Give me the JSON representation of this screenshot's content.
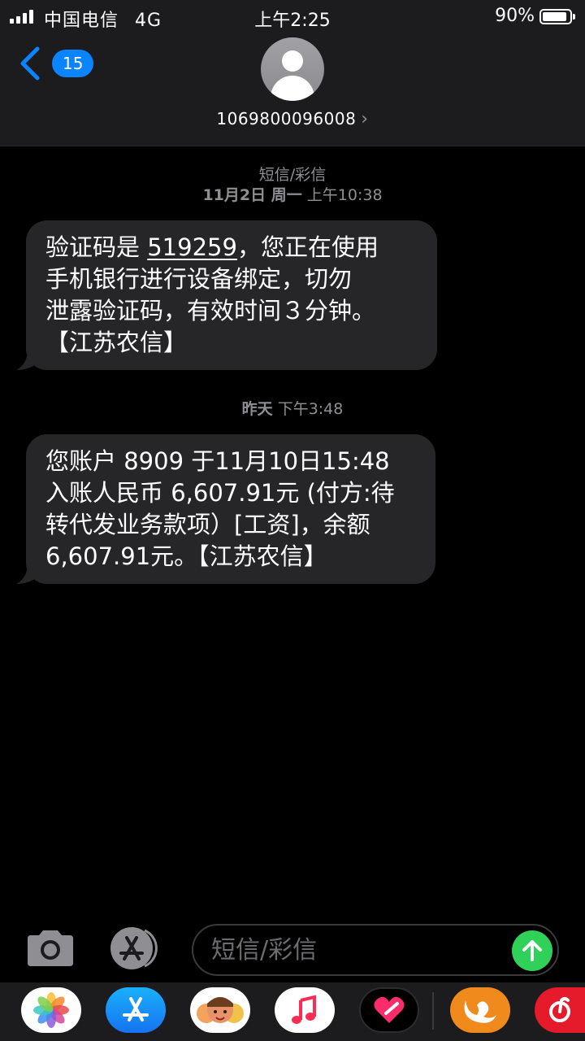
{
  "status_bar": {
    "carrier": "中国电信",
    "network": "4G",
    "time": "上午2:25",
    "battery_percent": "90%",
    "battery_level": 0.9
  },
  "header": {
    "back_count": "15",
    "contact_number": "1069800096008"
  },
  "messages": [
    {
      "meta_line1": "短信/彩信",
      "meta_date": "11月2日 周一",
      "meta_time": "上午10:38",
      "lines": [
        {
          "pre": "验证码是 ",
          "code": "519259",
          "post": "，您正在使用"
        },
        {
          "text": "手机银行进行设备绑定，切勿"
        },
        {
          "text": "泄露验证码，有效时间３分钟。"
        },
        {
          "text": "【江苏农信】"
        }
      ]
    },
    {
      "meta_date": "昨天",
      "meta_time": "下午3:48",
      "lines": [
        {
          "text": "您账户 8909 于11月10日15:48"
        },
        {
          "text": "入账人民币 6,607.91元 (付方:待"
        },
        {
          "text": "转代发业务款项）[工资]，余额"
        },
        {
          "text": "6,607.91元。【江苏农信】"
        }
      ]
    }
  ],
  "input": {
    "placeholder": "短信/彩信"
  },
  "icons": {
    "back": "chevron-left-icon",
    "camera": "camera-icon",
    "apps": "app-store-icon",
    "send": "arrow-up-icon"
  },
  "app_drawer": [
    "photos",
    "app-store",
    "memoji",
    "music",
    "digital-touch",
    "uc-browser",
    "netease-music"
  ],
  "colors": {
    "accent_blue": "#0a84ff",
    "send_green": "#30d158",
    "bubble_gray": "#262629"
  }
}
